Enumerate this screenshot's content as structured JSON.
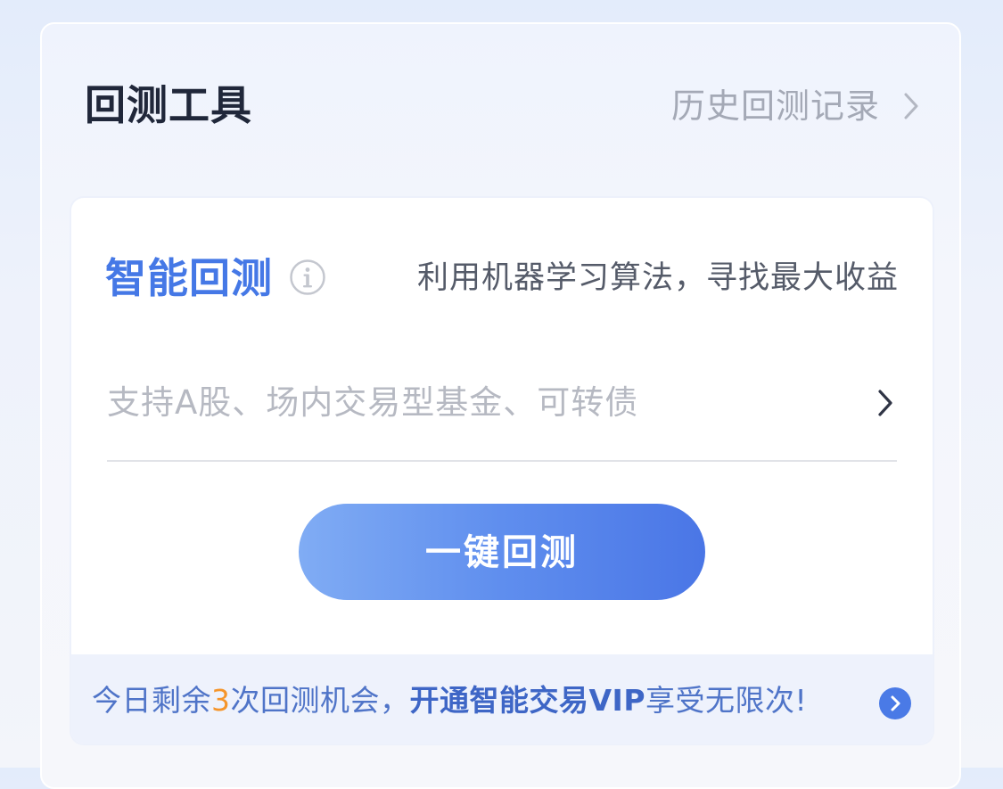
{
  "header": {
    "title": "回测工具",
    "history_link": "历史回测记录"
  },
  "smart_backtest": {
    "title": "智能回测",
    "description": "利用机器学习算法，寻找最大收益",
    "asset_selector": {
      "placeholder": "支持A股、场内交易型基金、可转债"
    },
    "run_button": "一键回测"
  },
  "promo": {
    "prefix": "今日剩余",
    "remaining_count": "3",
    "middle": "次回测机会，",
    "cta": "开通智能交易VIP",
    "suffix": "享受无限次!"
  },
  "colors": {
    "accent": "#4578e6",
    "highlight": "#f5952b",
    "button_gradient_start": "#80acf4",
    "button_gradient_end": "#4a76e6"
  },
  "icons": {
    "history": "chevron-right-icon",
    "info": "info-circle-icon",
    "asset_selector": "chevron-right-icon",
    "promo": "arrow-circle-right-icon"
  }
}
